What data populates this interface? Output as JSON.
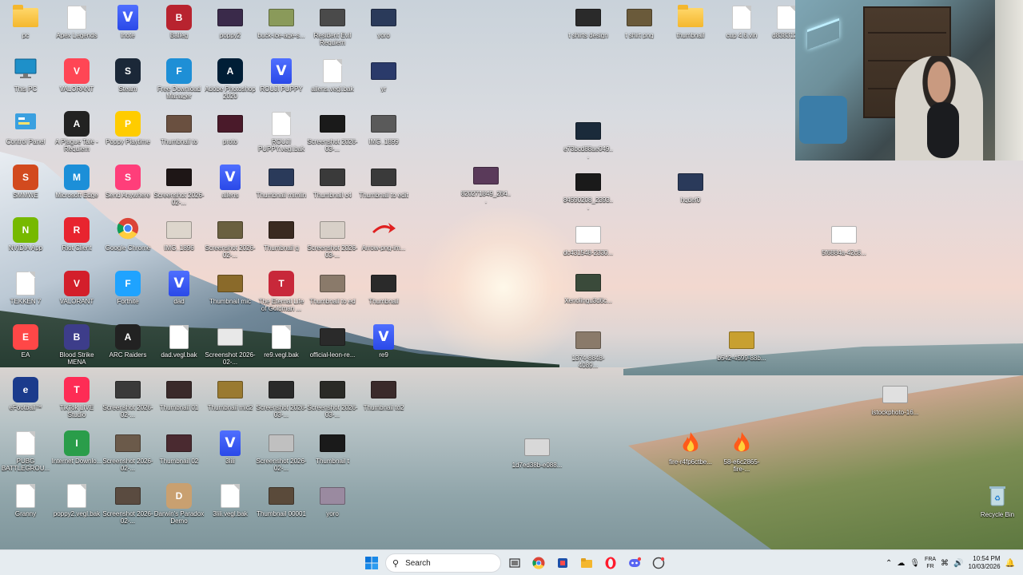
{
  "desktop": {
    "col1": [
      {
        "label": "pc",
        "type": "folder"
      },
      {
        "label": "This PC",
        "type": "monitor"
      },
      {
        "label": "Control Panel",
        "type": "control"
      },
      {
        "label": "SMMWE",
        "type": "app",
        "color": "#d24a1e"
      },
      {
        "label": "NVIDIA App",
        "type": "app",
        "color": "#76b900"
      },
      {
        "label": "TEKKEN 7",
        "type": "file"
      },
      {
        "label": "EA",
        "type": "app",
        "color": "#ff4747"
      },
      {
        "label": "eFootball™",
        "type": "app",
        "color": "#1b3b8c"
      },
      {
        "label": "PUBG BATTLEGROU...",
        "type": "file"
      },
      {
        "label": "Granny",
        "type": "file"
      }
    ],
    "col2": [
      {
        "label": "Apex Legends",
        "type": "file"
      },
      {
        "label": "VALORANT",
        "type": "app",
        "color": "#ff4655"
      },
      {
        "label": "A Plague Tale - Requiem",
        "type": "app",
        "color": "#222"
      },
      {
        "label": "Microsoft Edge",
        "type": "app",
        "color": "#1c8fd8"
      },
      {
        "label": "Riot Client",
        "type": "app",
        "color": "#e8242f"
      },
      {
        "label": "VALORANT",
        "type": "app",
        "color": "#d31f2b"
      },
      {
        "label": "Blood Strike MENA",
        "type": "app",
        "color": "#3d3d8a"
      },
      {
        "label": "TikTok LIVE Studio",
        "type": "app",
        "color": "#fe2c55"
      },
      {
        "label": "Internet Downlo...",
        "type": "app",
        "color": "#2a9d4a"
      },
      {
        "label": "poppy2.vegl.bak",
        "type": "file"
      }
    ],
    "col3": [
      {
        "label": "lnote",
        "type": "vdoc"
      },
      {
        "label": "Steam",
        "type": "app",
        "color": "#1b2838"
      },
      {
        "label": "Poppy Playtime",
        "type": "app",
        "color": "#ffcc00"
      },
      {
        "label": "Send Anywhere",
        "type": "app",
        "color": "#ff3e7a"
      },
      {
        "label": "Google Chrome",
        "type": "chrome"
      },
      {
        "label": "Fortnite",
        "type": "app",
        "color": "#1fa3ff"
      },
      {
        "label": "ARC Raiders",
        "type": "app",
        "color": "#222"
      },
      {
        "label": "Screenshot 2026-02-...",
        "type": "thumb",
        "color": "#3a3a3a"
      },
      {
        "label": "Screenshot 2026-02-...",
        "type": "thumb",
        "color": "#6b5a4a"
      },
      {
        "label": "Screenshot 2026-02-...",
        "type": "thumb",
        "color": "#5a4b40"
      }
    ],
    "col4": [
      {
        "label": "Balleg",
        "type": "app",
        "color": "#b8232f"
      },
      {
        "label": "Free Download Manager",
        "type": "app",
        "color": "#1e8fd6"
      },
      {
        "label": "Thumbnail to",
        "type": "thumb",
        "color": "#6a5040"
      },
      {
        "label": "Screenshot 2026-02-...",
        "type": "thumb",
        "color": "#1e1616"
      },
      {
        "label": "IMG_1896",
        "type": "thumb",
        "color": "#ddd6cc"
      },
      {
        "label": "dad",
        "type": "vdoc"
      },
      {
        "label": "dad.vegl.bak",
        "type": "file"
      },
      {
        "label": "Thumbnail 01",
        "type": "thumb",
        "color": "#3a2a2a"
      },
      {
        "label": "Thumbnail 02",
        "type": "thumb",
        "color": "#4a2a30"
      },
      {
        "label": "Darwin's Paradox Demo",
        "type": "app",
        "color": "#c9a070"
      }
    ],
    "col5": [
      {
        "label": "poppy2",
        "type": "thumb",
        "color": "#3a2a4a"
      },
      {
        "label": "Adobe Photoshop 2020",
        "type": "app",
        "color": "#001e36"
      },
      {
        "label": "proto",
        "type": "thumb",
        "color": "#4a1a2a"
      },
      {
        "label": "allens",
        "type": "vdoc"
      },
      {
        "label": "Screenshot 2026-02-...",
        "type": "thumb",
        "color": "#6a6040"
      },
      {
        "label": "Thumbnail mic",
        "type": "thumb",
        "color": "#8a6a2a"
      },
      {
        "label": "Screenshot 2026-02-...",
        "type": "thumb",
        "color": "#e8e8e8"
      },
      {
        "label": "Thumbnail mic2",
        "type": "thumb",
        "color": "#9a7a30"
      },
      {
        "label": "3lili",
        "type": "vdoc"
      },
      {
        "label": "3lili.vegl.bak",
        "type": "file"
      }
    ],
    "col6": [
      {
        "label": "buck-ice-age-s...",
        "type": "thumb",
        "color": "#8a9a5a"
      },
      {
        "label": "ROUJI PUPPY",
        "type": "vdoc"
      },
      {
        "label": "ROUJI PUPPY.vegl.bak",
        "type": "file"
      },
      {
        "label": "Thumbnail mimlin",
        "type": "thumb",
        "color": "#2a3a5a"
      },
      {
        "label": "Thumbnail g",
        "type": "thumb",
        "color": "#3a2a20"
      },
      {
        "label": "The Eternal Life of Goldman ...",
        "type": "app",
        "color": "#c8283a"
      },
      {
        "label": "re9.vegl.bak",
        "type": "file"
      },
      {
        "label": "Screenshot 2026-03-...",
        "type": "thumb",
        "color": "#2a2a2a"
      },
      {
        "label": "Screenshot 2026-02-...",
        "type": "thumb",
        "color": "#c0c0c0"
      },
      {
        "label": "Thumbnail 00001",
        "type": "thumb",
        "color": "#5a4a3a"
      }
    ],
    "col7": [
      {
        "label": "Resident Evil Requiem",
        "type": "thumb",
        "color": "#4a4a4a"
      },
      {
        "label": "allens.vegl.bak",
        "type": "file"
      },
      {
        "label": "Screenshot 2026-03-...",
        "type": "thumb",
        "color": "#1a1a1a"
      },
      {
        "label": "Thumbnail c4",
        "type": "thumb",
        "color": "#3a3a3a"
      },
      {
        "label": "Screenshot 2026-03-...",
        "type": "thumb",
        "color": "#d8d0c8"
      },
      {
        "label": "Thumbnail to ed",
        "type": "thumb",
        "color": "#8a7a6a"
      },
      {
        "label": "official-leon-re...",
        "type": "thumb",
        "color": "#2a2a2a"
      },
      {
        "label": "Screenshot 2026-03-...",
        "type": "thumb",
        "color": "#2a2a26"
      },
      {
        "label": "Thumbnail t",
        "type": "thumb",
        "color": "#1a1a1a"
      },
      {
        "label": "yoro",
        "type": "thumb",
        "color": "#9a8aa0"
      }
    ],
    "col8": [
      {
        "label": "yoro",
        "type": "thumb",
        "color": "#2a3a5a"
      },
      {
        "label": "yr",
        "type": "thumb",
        "color": "#2a3a6a"
      },
      {
        "label": "IMG_1899",
        "type": "thumb",
        "color": "#5a5a5a"
      },
      {
        "label": "Thumbnail to edit",
        "type": "thumb",
        "color": "#3a3a3a"
      },
      {
        "label": "Arrow-png-im...",
        "type": "arrow"
      },
      {
        "label": "Thumbnail",
        "type": "thumb",
        "color": "#2a2a2a"
      },
      {
        "label": "re9",
        "type": "vdoc"
      },
      {
        "label": "Thumbnail to2",
        "type": "thumb",
        "color": "#3a2a2a"
      }
    ],
    "scattered": [
      {
        "label": "t shirts design",
        "type": "thumb",
        "color": "#2a2a2a",
        "pos": "a"
      },
      {
        "label": "t shirt png",
        "type": "thumb",
        "color": "#6a5a3a",
        "pos": "b"
      },
      {
        "label": "thumbnail",
        "type": "folder",
        "pos": "c"
      },
      {
        "label": "cup 4.6.vin",
        "type": "file",
        "pos": "d"
      },
      {
        "label": "d8383123",
        "type": "file",
        "pos": "e"
      },
      {
        "label": "e73bcd88ae049...",
        "type": "thumb",
        "color": "#1a2a3a",
        "pos": "f"
      },
      {
        "label": "820271849_264...",
        "type": "thumb",
        "color": "#5a3a5a",
        "pos": "g"
      },
      {
        "label": "84590208_2393...",
        "type": "thumb",
        "color": "#1a1a1a",
        "pos": "h"
      },
      {
        "label": "hqdef0",
        "type": "thumb",
        "color": "#2a3a5a",
        "pos": "i"
      },
      {
        "label": "dc431548-2330...",
        "type": "thumb",
        "color": "#ffffff",
        "pos": "j"
      },
      {
        "label": "5f6884a-42c8...",
        "type": "thumb",
        "color": "#ffffff",
        "pos": "k"
      },
      {
        "label": "Xenolingu3d6c...",
        "type": "thumb",
        "color": "#3a4a3a",
        "pos": "l"
      },
      {
        "label": "1374-8848-4089...",
        "type": "thumb",
        "color": "#8a7a6a",
        "pos": "m"
      },
      {
        "label": "b542-4599-88b...",
        "type": "thumb",
        "color": "#c8a030",
        "pos": "n"
      },
      {
        "label": "istockphoto-16...",
        "type": "thumb",
        "color": "#e0e0e0",
        "pos": "o"
      },
      {
        "label": "1d7ed38b-e088...",
        "type": "thumb",
        "color": "#d8d8d8",
        "pos": "p"
      },
      {
        "label": "fire-r4fp6ctbe...",
        "type": "fire",
        "pos": "q"
      },
      {
        "label": "58-e6c2865-fire-...",
        "type": "fire",
        "pos": "r"
      },
      {
        "label": "Recycle Bin",
        "type": "bin",
        "pos": "s"
      }
    ]
  },
  "taskbar": {
    "search_placeholder": "Search",
    "apps": [
      "start-icon",
      "search-box",
      "task-view-icon",
      "chrome-icon",
      "snipping-icon",
      "file-explorer-icon",
      "opera-icon",
      "discord-icon",
      "app-icon"
    ],
    "tray": {
      "lang_top": "FRA",
      "lang_bottom": "FR",
      "time": "10:54 PM",
      "date": "10/03/2026"
    }
  }
}
